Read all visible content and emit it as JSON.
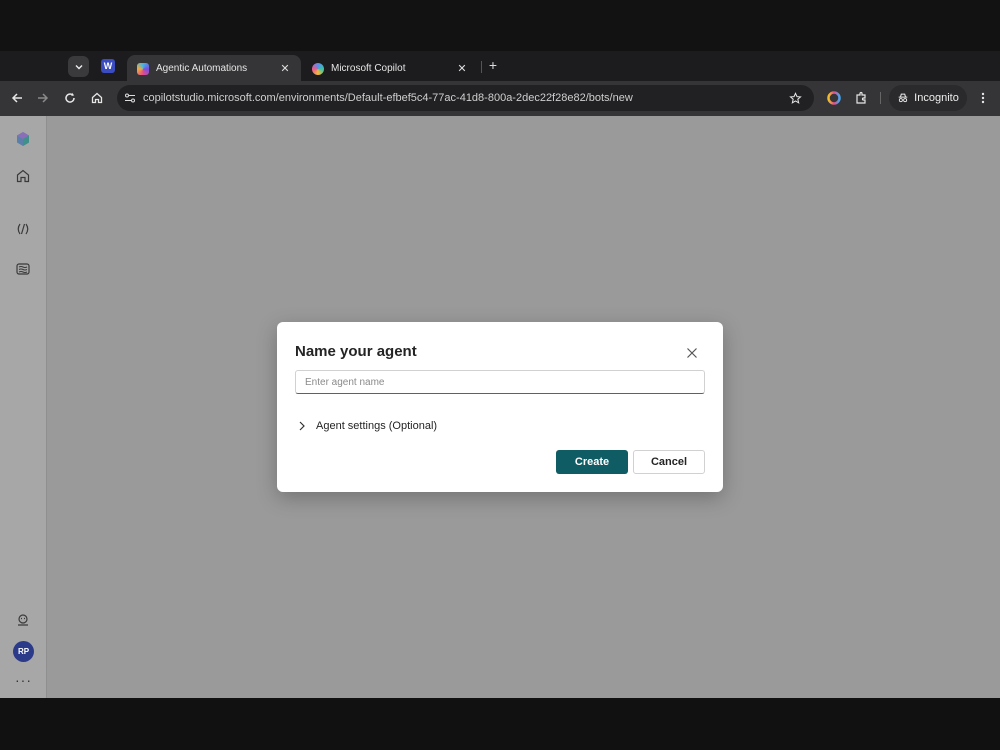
{
  "browser": {
    "tabs": [
      {
        "title": "Agentic Automations",
        "active": true
      },
      {
        "title": "Microsoft Copilot",
        "active": false
      }
    ],
    "pinned_tab_letter": "W",
    "url": "copilotstudio.microsoft.com/environments/Default-efbef5c4-77ac-41d8-800a-2dec22f28e82/bots/new",
    "incognito_label": "Incognito"
  },
  "sidebar": {
    "avatar_initials": "RP",
    "more_label": "···"
  },
  "dialog": {
    "title": "Name your agent",
    "input_placeholder": "Enter agent name",
    "input_value": "",
    "settings_label": "Agent settings (Optional)",
    "create_label": "Create",
    "cancel_label": "Cancel"
  },
  "colors": {
    "primary_button": "#0f5c64",
    "overlay": "#9a9a9a"
  }
}
